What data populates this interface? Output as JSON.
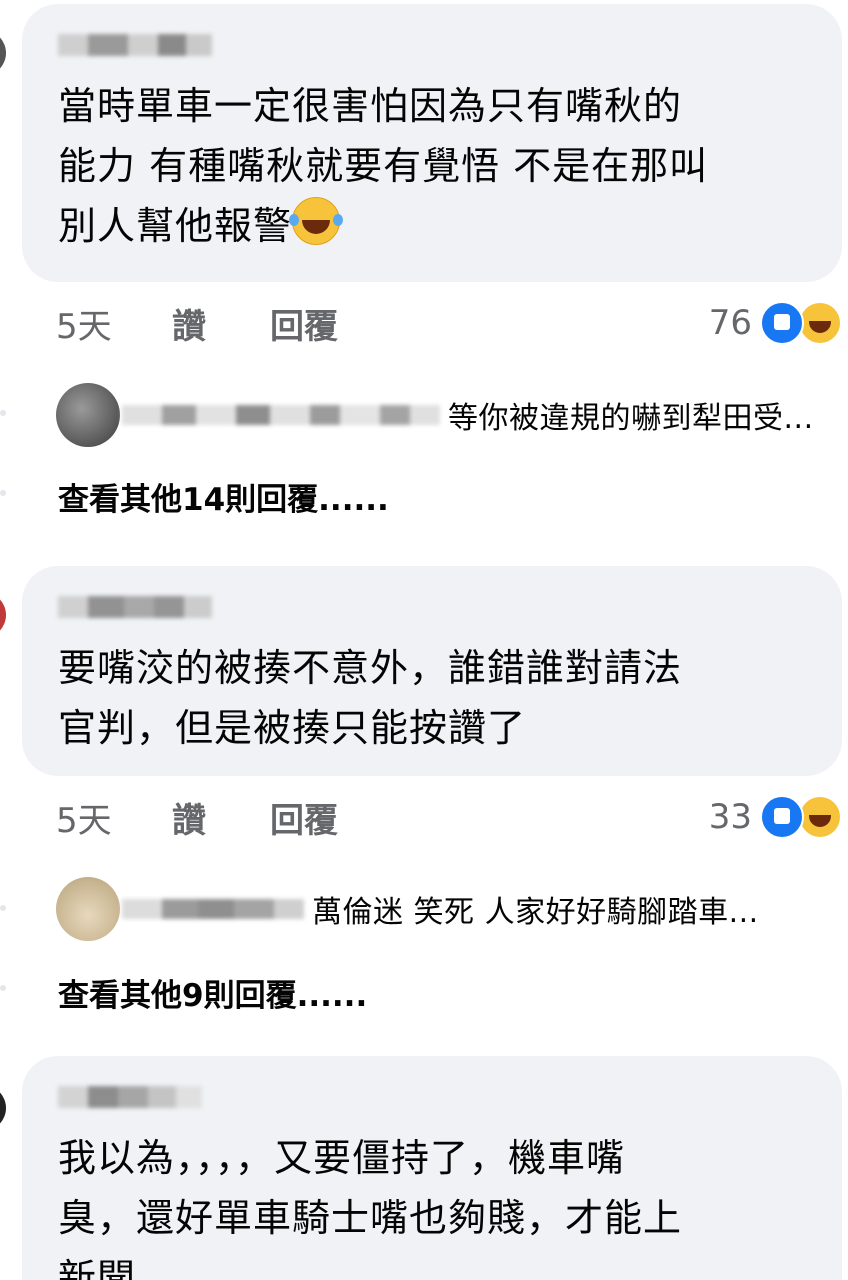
{
  "colors": {
    "bubble_bg": "#f0f2f5",
    "text": "#050505",
    "meta": "#65676b",
    "like_blue": "#1877f2",
    "haha_yellow": "#f7c33a"
  },
  "comments": [
    {
      "text": "當時單車一定很害怕因為只有嘴秋的\n能力 有種嘴秋就要有覺悟 不是在那叫\n別人幫他報警",
      "emoji": "laughing-tears-emoji",
      "time": "5天",
      "like_label": "讚",
      "reply_label": "回覆",
      "reaction_count": "76",
      "reply_preview": "等你被違規的嚇到犁田受...",
      "more_replies": "查看其他14則回覆......"
    },
    {
      "text": "要嘴洨的被揍不意外，誰錯誰對請法\n官判，但是被揍只能按讚了",
      "time": "5天",
      "like_label": "讚",
      "reply_label": "回覆",
      "reaction_count": "33",
      "reply_preview": "萬倫迷 笑死 人家好好騎腳踏車...",
      "more_replies": "查看其他9則回覆......"
    },
    {
      "text": "我以為，，，，又要僵持了，機車嘴\n臭，還好單車騎士嘴也夠賤，才能上\n新聞"
    }
  ]
}
